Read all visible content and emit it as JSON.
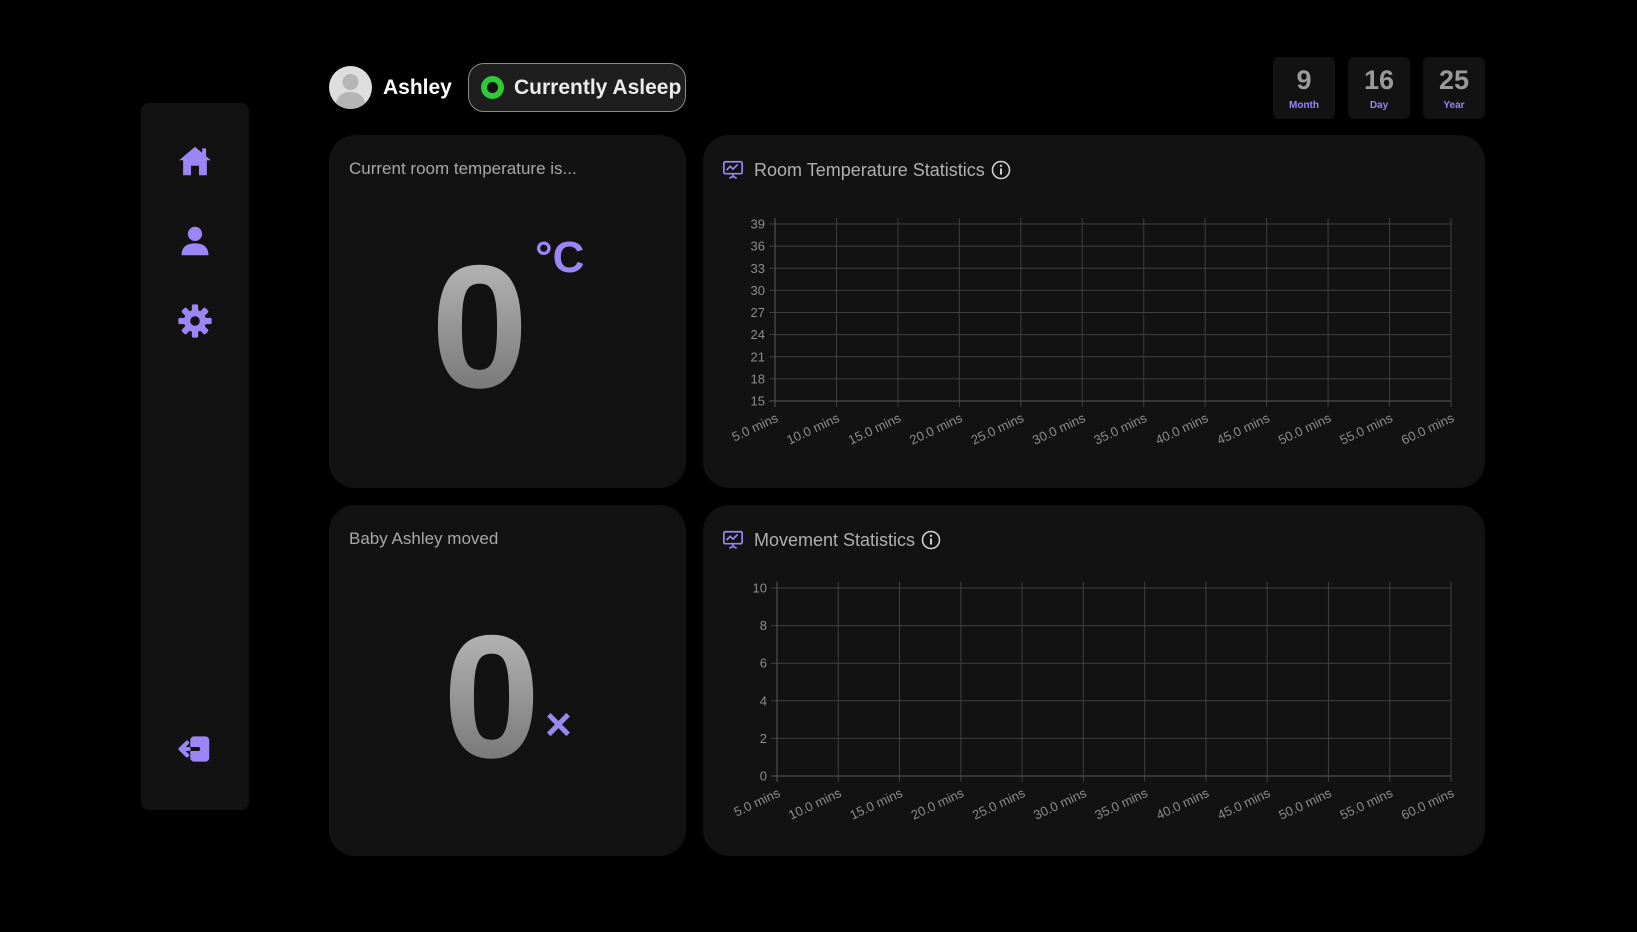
{
  "sidebar": {
    "items": [
      {
        "icon": "home-icon"
      },
      {
        "icon": "user-icon"
      },
      {
        "icon": "gear-icon"
      }
    ],
    "logout_icon": "logout-icon"
  },
  "header": {
    "user_name": "Ashley",
    "status": "Currently Asleep",
    "status_color": "#2fc93a"
  },
  "date": {
    "month_value": "9",
    "month_label": "Month",
    "day_value": "16",
    "day_label": "Day",
    "year_value": "25",
    "year_label": "Year"
  },
  "temperature_card": {
    "title": "Current room temperature is...",
    "value": "0",
    "unit": "°C"
  },
  "movement_card": {
    "title": "Baby Ashley moved",
    "value": "0",
    "unit": "×"
  },
  "temperature_chart": {
    "title": "Room Temperature Statistics"
  },
  "movement_chart": {
    "title": "Movement Statistics"
  },
  "accent_color": "#9b86f5",
  "chart_data": [
    {
      "type": "line",
      "title": "Room Temperature Statistics",
      "categories": [
        "5.0 mins",
        "10.0 mins",
        "15.0 mins",
        "20.0 mins",
        "25.0 mins",
        "30.0 mins",
        "35.0 mins",
        "40.0 mins",
        "45.0 mins",
        "50.0 mins",
        "55.0 mins",
        "60.0 mins"
      ],
      "yticks": [
        15,
        18,
        21,
        24,
        27,
        30,
        33,
        36,
        39
      ],
      "ylim": [
        15,
        39
      ],
      "series": [],
      "grid": true
    },
    {
      "type": "line",
      "title": "Movement Statistics",
      "categories": [
        "5.0 mins",
        "10.0 mins",
        "15.0 mins",
        "20.0 mins",
        "25.0 mins",
        "30.0 mins",
        "35.0 mins",
        "40.0 mins",
        "45.0 mins",
        "50.0 mins",
        "55.0 mins",
        "60.0 mins"
      ],
      "yticks": [
        0,
        2,
        4,
        6,
        8,
        10
      ],
      "ylim": [
        0,
        10
      ],
      "series": [],
      "grid": true
    }
  ]
}
